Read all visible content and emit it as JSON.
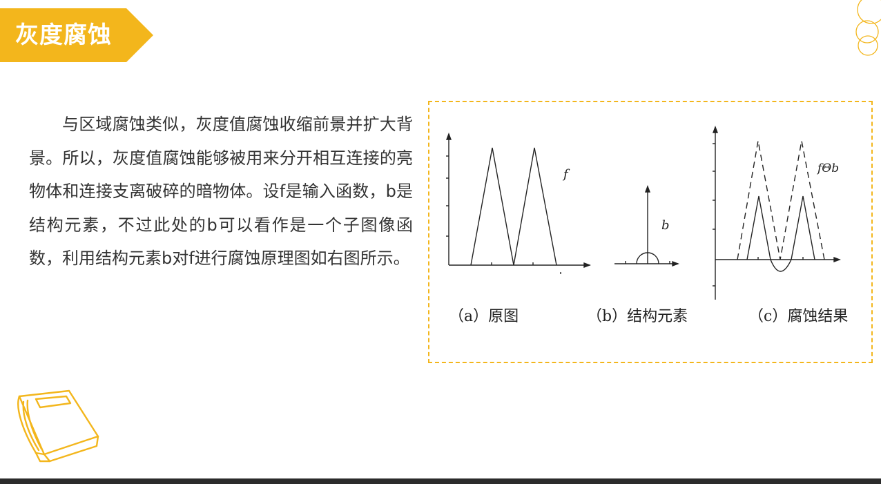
{
  "title": "灰度腐蚀",
  "paragraph": "与区域腐蚀类似，灰度值腐蚀收缩前景并扩大背景。所以，灰度值腐蚀能够被用来分开相互连接的亮物体和连接支离破碎的暗物体。设f是输入函数，b是结构元素，不过此处的b可以看作是一个子图像函数，利用结构元素b对f进行腐蚀原理图如右图所示。",
  "figure": {
    "captions": {
      "a": "（a）原图",
      "b": "（b）结构元素",
      "c": "（c）腐蚀结果"
    },
    "labels": {
      "f": "f",
      "b": "b",
      "result": "fΘb"
    }
  },
  "colors": {
    "accent": "#f3b61c",
    "text": "#333333",
    "bottom_bar": "#2b2b2b"
  },
  "icons": [
    "title-arrow-banner",
    "circles-decoration",
    "book-icon"
  ]
}
